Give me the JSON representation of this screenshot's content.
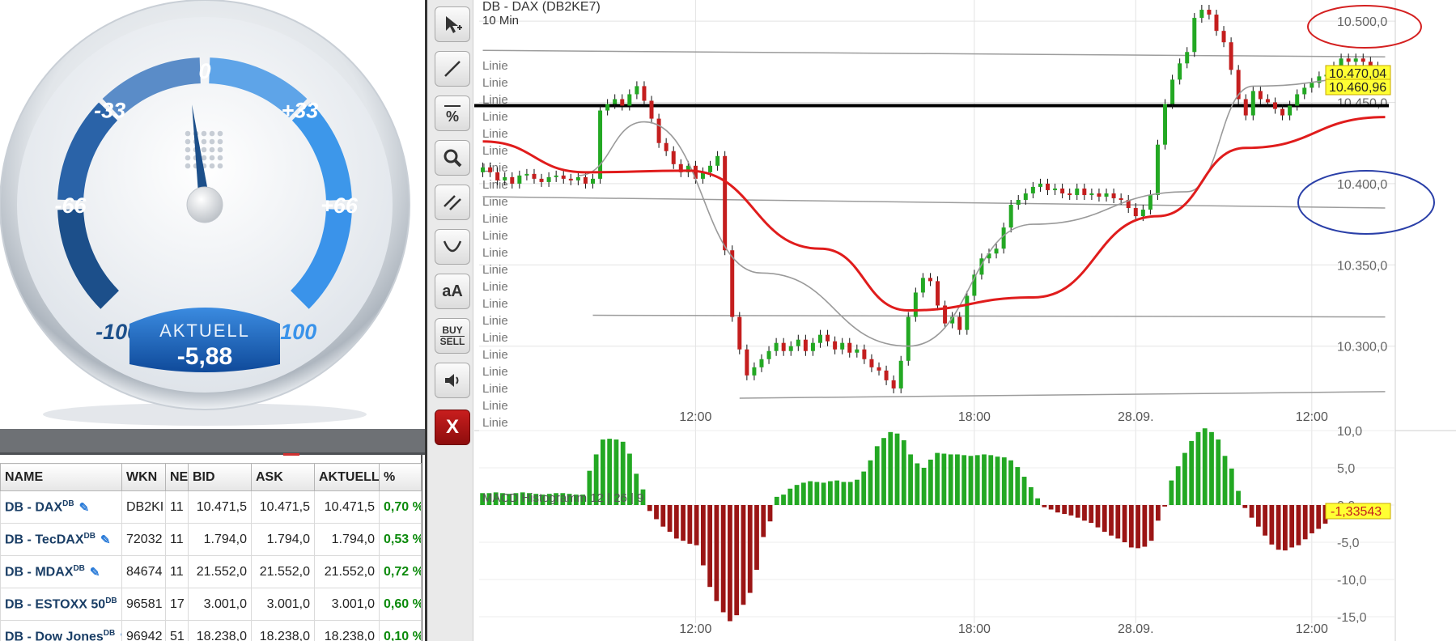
{
  "gauge": {
    "ticks": [
      "-100",
      "-66",
      "-33",
      "0",
      "+33",
      "+66",
      "+100"
    ],
    "value_label": "AKTUELL",
    "value": "-5,88",
    "value_number": -5.88,
    "colors": {
      "dark": "#1c4f8a",
      "light": "#3d97ea"
    }
  },
  "quotes": {
    "columns": [
      "NAME",
      "WKN",
      "NE",
      "BID",
      "ASK",
      "AKTUELL",
      "%"
    ],
    "rows": [
      {
        "name": "DB - DAX",
        "sup": "DB",
        "wkn": "DB2KI",
        "ne": "11",
        "bid": "10.471,5",
        "ask": "10.471,5",
        "aktuell": "10.471,5",
        "pct": "0,70 %"
      },
      {
        "name": "DB - TecDAX",
        "sup": "DB",
        "wkn": "72032",
        "ne": "11",
        "bid": "1.794,0",
        "ask": "1.794,0",
        "aktuell": "1.794,0",
        "pct": "0,53 %"
      },
      {
        "name": "DB - MDAX",
        "sup": "DB",
        "wkn": "84674",
        "ne": "11",
        "bid": "21.552,0",
        "ask": "21.552,0",
        "aktuell": "21.552,0",
        "pct": "0,72 %"
      },
      {
        "name": "DB - ESTOXX 50",
        "sup": "DB",
        "wkn": "96581",
        "ne": "17",
        "bid": "3.001,0",
        "ask": "3.001,0",
        "aktuell": "3.001,0",
        "pct": "0,60 %"
      },
      {
        "name": "DB - Dow Jones",
        "sup": "DB",
        "wkn": "96942",
        "ne": "51",
        "bid": "18.238,0",
        "ask": "18.238,0",
        "aktuell": "18.238,0",
        "pct": "0,10 %"
      }
    ]
  },
  "toolbar": {
    "tools": [
      {
        "name": "pointer-tool",
        "icon": "↖"
      },
      {
        "name": "line-tool",
        "icon": "/"
      },
      {
        "name": "percent-tool",
        "icon": "%"
      },
      {
        "name": "zoom-tool",
        "icon": "search-icon"
      },
      {
        "name": "channel-tool",
        "icon": "//"
      },
      {
        "name": "arc-tool",
        "icon": "◡"
      },
      {
        "name": "text-tool",
        "icon": "aA"
      },
      {
        "name": "buy-sell-tool",
        "icon": "BUY SELL"
      },
      {
        "name": "sound-tool",
        "icon": "speaker-icon"
      },
      {
        "name": "close-tool",
        "icon": "X"
      }
    ]
  },
  "chart": {
    "title": "DB - DAX (DB2KE7)",
    "interval": "10 Min",
    "line_label": "Linie",
    "line_label_count": 22,
    "last_price_labels": [
      "10.470,04",
      "10.460,96"
    ],
    "macd_label": "MACD Histogramm  12 | 26 | 9",
    "macd_last_label": "-1,33543",
    "colors": {
      "up": "#23a823",
      "down": "#c41e1e",
      "ma_slow": "#e01c1c",
      "ma_fast": "#9a9a9a",
      "marker": "#ffff33",
      "circle_red": "#d42020",
      "circle_blue": "#2a3fa8"
    }
  },
  "chart_data": [
    {
      "type": "candlestick",
      "title": "DB - DAX (DB2KE7)",
      "subtitle": "10 Min",
      "x_ticks": [
        "12:00",
        "18:00",
        "28.09.",
        "12:00"
      ],
      "y_ticks": [
        "10.300,0",
        "10.350,0",
        "10.400,0",
        "10.450,0",
        "10.500,0"
      ],
      "ylim": [
        10264,
        10513
      ],
      "close": [
        10410,
        10407,
        10402,
        10404,
        10400,
        10405,
        10406,
        10403,
        10401,
        10404,
        10405,
        10403,
        10402,
        10404,
        10400,
        10403,
        10445,
        10449,
        10452,
        10448,
        10455,
        10460,
        10451,
        10440,
        10425,
        10420,
        10412,
        10407,
        10411,
        10403,
        10407,
        10411,
        10417,
        10359,
        10318,
        10298,
        10282,
        10287,
        10292,
        10297,
        10302,
        10297,
        10300,
        10304,
        10297,
        10302,
        10307,
        10303,
        10298,
        10302,
        10296,
        10298,
        10292,
        10287,
        10285,
        10279,
        10274,
        10291,
        10318,
        10333,
        10342,
        10340,
        10325,
        10314,
        10318,
        10310,
        10331,
        10344,
        10354,
        10357,
        10360,
        10373,
        10387,
        10390,
        10394,
        10398,
        10400,
        10396,
        10397,
        10394,
        10393,
        10397,
        10393,
        10394,
        10392,
        10394,
        10391,
        10390,
        10385,
        10380,
        10384,
        10393,
        10424,
        10449,
        10464,
        10474,
        10481,
        10502,
        10507,
        10504,
        10494,
        10487,
        10470,
        10452,
        10442,
        10457,
        10452,
        10450,
        10446,
        10442,
        10448,
        10455,
        10459,
        10462,
        10466,
        10467,
        10472,
        10477,
        10475,
        10477,
        10475,
        10472,
        10465,
        10460
      ],
      "ma_slow": {
        "x": [
          0,
          14,
          28,
          46,
          58,
          75,
          92,
          104,
          123
        ],
        "y": [
          10426,
          10407,
          10408,
          10360,
          10322,
          10330,
          10380,
          10422,
          10441
        ]
      },
      "ma_fast": {
        "x": [
          13,
          22,
          38,
          58,
          75,
          96,
          105,
          123
        ],
        "y": [
          10405,
          10438,
          10345,
          10300,
          10375,
          10395,
          10460,
          10466
        ]
      },
      "hlines": [
        10448
      ],
      "trendlines": [
        [
          0,
          10482,
          123,
          10478
        ],
        [
          0,
          10392,
          123,
          10385
        ],
        [
          15,
          10319,
          123,
          10318
        ],
        [
          35,
          10268,
          123,
          10272
        ]
      ],
      "last_values": [
        "10.470,04",
        "10.460,96"
      ]
    },
    {
      "type": "bar",
      "title": "MACD Histogramm  12 | 26 | 9",
      "y_ticks": [
        "10,0",
        "5,0",
        "0,0",
        "-5,0",
        "-10,0",
        "-15,0"
      ],
      "x_ticks": [
        "12:00",
        "18:00",
        "28.09.",
        "12:00"
      ],
      "ylim": [
        -15,
        10
      ],
      "values": [
        1.6,
        1.6,
        1.7,
        1.6,
        1.5,
        1.6,
        1.7,
        1.6,
        1.5,
        1.4,
        1.5,
        1.6,
        1.6,
        1.5,
        1.4,
        1.4,
        4.6,
        6.8,
        8.8,
        8.9,
        8.8,
        8.5,
        6.9,
        4.2,
        2.1,
        -0.8,
        -1.9,
        -2.9,
        -3.6,
        -4.5,
        -4.8,
        -5.2,
        -5.4,
        -8.1,
        -11.0,
        -12.9,
        -14.4,
        -15.6,
        -14.8,
        -13.4,
        -11.8,
        -8.7,
        -4.3,
        -2.2,
        1.1,
        1.4,
        2.2,
        2.7,
        3.0,
        3.2,
        3.1,
        3.0,
        3.2,
        3.3,
        3.1,
        3.1,
        3.4,
        4.5,
        6.0,
        7.9,
        9.0,
        9.8,
        9.6,
        8.7,
        6.8,
        5.6,
        5.0,
        6.1,
        7.0,
        6.9,
        6.8,
        6.8,
        6.7,
        6.6,
        6.7,
        6.8,
        6.7,
        6.5,
        6.4,
        6.0,
        5.1,
        3.8,
        2.4,
        0.9,
        -0.3,
        -0.6,
        -1.0,
        -1.2,
        -1.4,
        -1.7,
        -2.1,
        -2.4,
        -3.0,
        -3.6,
        -4.1,
        -4.5,
        -5.0,
        -5.7,
        -5.8,
        -5.6,
        -4.8,
        -2.1,
        -0.2,
        3.3,
        5.2,
        7.0,
        8.6,
        9.8,
        10.3,
        9.8,
        8.8,
        6.6,
        4.9,
        1.9,
        -0.4,
        -1.7,
        -2.9,
        -4.1,
        -5.3,
        -6.0,
        -6.1,
        -5.7,
        -5.4,
        -4.6,
        -3.8,
        -3.2,
        -2.5,
        -1.8,
        -1.3,
        -0.9,
        -0.6,
        -0.5,
        -0.4,
        -0.3,
        -0.6,
        -1.3
      ],
      "last_value": "-1,33543"
    }
  ]
}
